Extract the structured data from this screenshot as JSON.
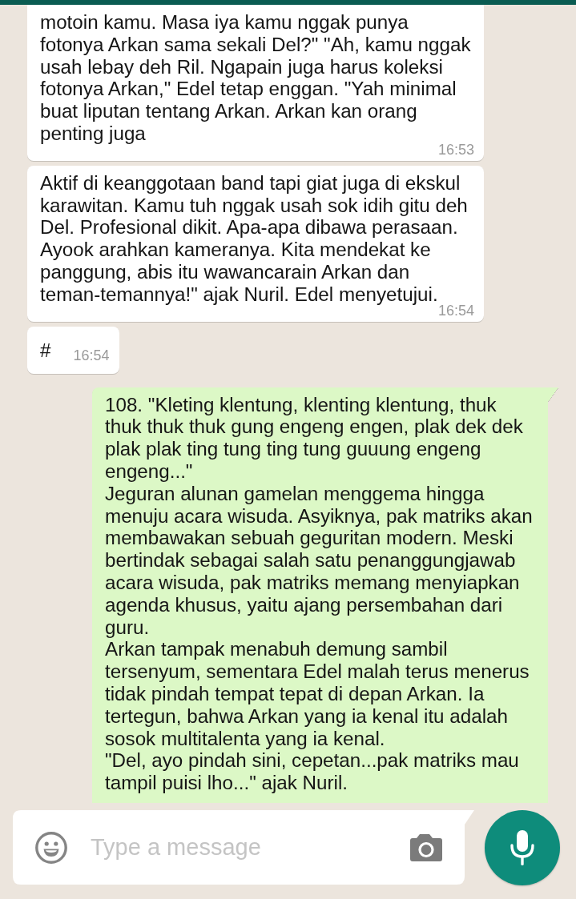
{
  "messages": [
    {
      "kind": "incoming",
      "tail": false,
      "paragraphs": [
        "motoin kamu. Masa iya kamu nggak punya fotonya Arkan sama sekali Del?\" \"Ah, kamu nggak usah lebay deh Ril. Ngapain juga harus koleksi fotonya Arkan,\" Edel tetap enggan. \"Yah minimal buat liputan tentang Arkan. Arkan kan orang penting juga"
      ],
      "time": "16:53"
    },
    {
      "kind": "incoming",
      "tail": false,
      "paragraphs": [
        "Aktif di keanggotaan band tapi giat juga di ekskul karawitan. Kamu tuh nggak usah sok idih gitu deh Del. Profesional dikit. Apa-apa dibawa perasaan. Ayook arahkan kameranya. Kita mendekat ke panggung, abis itu wawancarain Arkan dan teman-temannya!\" ajak Nuril. Edel menyetujui."
      ],
      "time": "16:54"
    },
    {
      "kind": "incoming",
      "tail": false,
      "paragraphs": [
        "#"
      ],
      "time": "16:54"
    },
    {
      "kind": "outgoing",
      "tail": true,
      "paragraphs": [
        "108. \"Kleting klentung, klenting klentung, thuk thuk thuk thuk gung engeng engen, plak dek dek plak plak ting tung ting tung guuung engeng engeng...\"",
        "Jeguran alunan gamelan menggema hingga menuju acara wisuda. Asyiknya, pak matriks akan membawakan sebuah geguritan modern. Meski bertindak sebagai salah satu penanggungjawab acara wisuda, pak matriks memang menyiapkan agenda khusus, yaitu ajang persembahan dari guru.",
        "Arkan tampak menabuh demung sambil tersenyum, sementara Edel malah terus menerus tidak pindah tempat tepat di depan Arkan. Ia tertegun, bahwa Arkan yang ia kenal itu adalah sosok multitalenta yang ia kenal.",
        "\"Del, ayo pindah sini, cepetan...pak matriks mau tampil puisi lho...\" ajak Nuril."
      ]
    }
  ],
  "composer": {
    "placeholder": "Type a message"
  }
}
